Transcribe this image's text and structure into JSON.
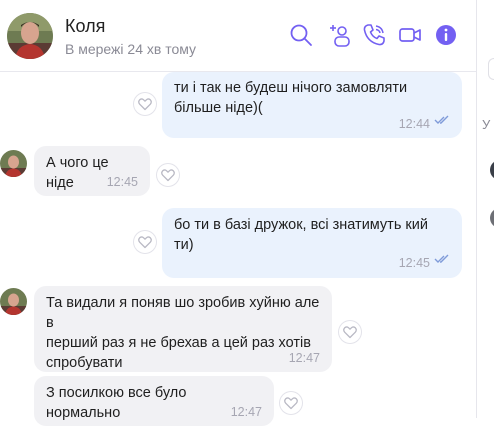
{
  "contact": {
    "name": "Коля",
    "status": "В мережі 24 хв тому"
  },
  "header_icons": [
    "search-icon",
    "add-contact-icon",
    "call-icon",
    "video-call-icon",
    "info-icon"
  ],
  "colors": {
    "accent": "#7360f2",
    "outgoing_bubble": "#eaf2fd",
    "incoming_bubble": "#f1f1f4",
    "time_text": "#a6a6b2",
    "ticks": "#7f9bd9"
  },
  "messages": [
    {
      "direction": "out",
      "text": "ти і так не будеш нічого замовляти\nбільше ніде)(",
      "time": "12:44",
      "read": true
    },
    {
      "direction": "in",
      "text": "А чого це ніде",
      "time": "12:45"
    },
    {
      "direction": "out",
      "text": "бо ти в базі дружок, всі знатимуть кий\nти)",
      "time": "12:45",
      "read": true
    },
    {
      "direction": "in",
      "text": "Та видали я поняв шо зробив хуйню але в\nперший раз я не брехав а цей раз хотів\nспробувати",
      "time": "12:47"
    },
    {
      "direction": "in",
      "text": "З посилкою все було нормально",
      "time": "12:47"
    }
  ],
  "right_panel": {
    "letter": "У"
  }
}
